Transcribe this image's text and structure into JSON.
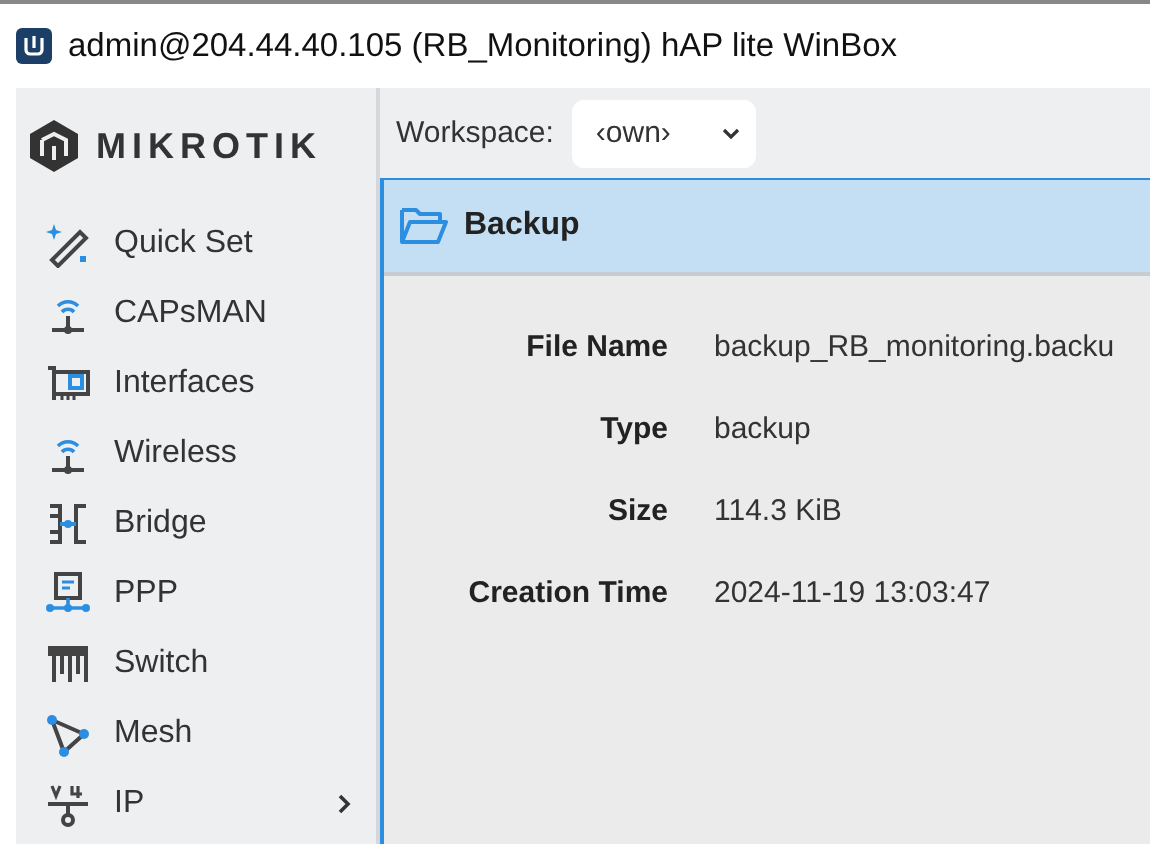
{
  "window": {
    "title": "admin@204.44.40.105 (RB_Monitoring) hAP lite WinBox"
  },
  "logo": {
    "text": "MIKROTIK"
  },
  "sidebar": {
    "items": [
      {
        "label": "Quick Set",
        "submenu": false
      },
      {
        "label": "CAPsMAN",
        "submenu": false
      },
      {
        "label": "Interfaces",
        "submenu": false
      },
      {
        "label": "Wireless",
        "submenu": false
      },
      {
        "label": "Bridge",
        "submenu": false
      },
      {
        "label": "PPP",
        "submenu": false
      },
      {
        "label": "Switch",
        "submenu": false
      },
      {
        "label": "Mesh",
        "submenu": false
      },
      {
        "label": "IP",
        "submenu": true
      }
    ]
  },
  "workspace": {
    "label": "Workspace:",
    "value": "‹own›"
  },
  "panel": {
    "title": "Backup",
    "fields": [
      {
        "label": "File Name",
        "value": "backup_RB_monitoring.backu"
      },
      {
        "label": "Type",
        "value": "backup"
      },
      {
        "label": "Size",
        "value": "114.3 KiB"
      },
      {
        "label": "Creation Time",
        "value": "2024-11-19 13:03:47"
      }
    ]
  }
}
